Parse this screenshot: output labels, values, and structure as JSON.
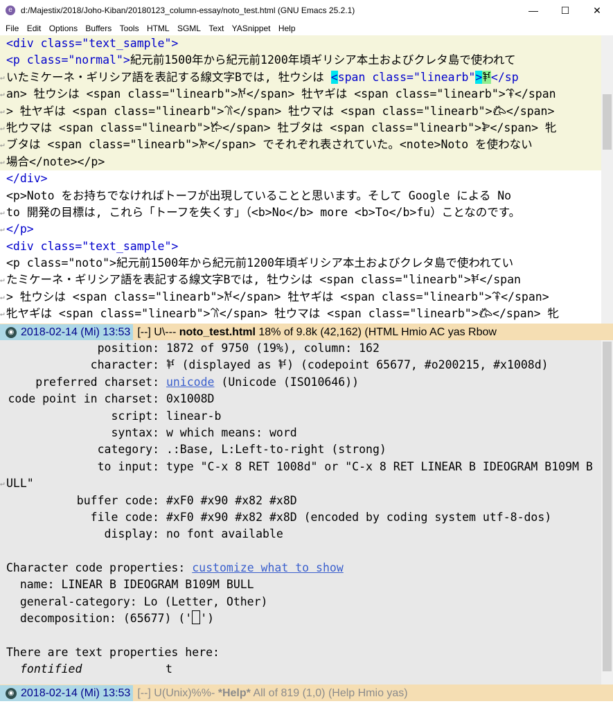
{
  "window": {
    "title": "d:/Majestix/2018/Joho-Kiban/20180123_column-essay/noto_test.html (GNU Emacs 25.2.1)",
    "minimize": "—",
    "maximize": "☐",
    "close": "✕"
  },
  "menu": [
    "File",
    "Edit",
    "Options",
    "Buffers",
    "Tools",
    "HTML",
    "SGML",
    "Text",
    "YASnippet",
    "Help"
  ],
  "editor": {
    "l1_tag": "<div class=\"text_sample\">",
    "l2a": "<p class=\"normal\">",
    "l2b": "紀元前1500年から紀元前1200年頃ギリシア本土およびクレタ島で使われて",
    "l3a": "いたミケーネ・ギリシア語を表記する線文字Bでは, 牡ウシは ",
    "l3_cursor": "<",
    "l3b": "span class=\"linearb\"",
    "l3_cursor2": ">",
    "l3_tofu": "𐂍",
    "l3c": "</sp",
    "l4": "an> 牡ウシは <span class=\"linearb\">𐂌</span> 牡ヤギは <span class=\"linearb\">𐂉</span",
    "l5": "> 牡ヤギは <span class=\"linearb\">𐂈</span> 牡ウマは <span class=\"linearb\">𐂃</span>",
    "l6": "牝ウマは <span class=\"linearb\">𐂂</span> 牡ブタは <span class=\"linearb\">𐂋</span> 牝",
    "l7": "ブタは <span class=\"linearb\">𐂊</span> でそれぞれ表されていた。<note>Noto を使わない",
    "l8": "場合</note></p>",
    "l9": "</div>",
    "l10": "<p>Noto をお持ちでなければトーフが出現していることと思います。そして Google による No",
    "l11": "to 開発の目標は, これら「トーフを失くす」（<b>No</b> more <b>To</b>fu）ことなのです。",
    "l12": "</p>",
    "l13": "<div class=\"text_sample\">",
    "l14": "<p class=\"noto\">紀元前1500年から紀元前1200年頃ギリシア本土およびクレタ島で使われてい",
    "l15": "たミケーネ・ギリシア語を表記する線文字Bでは, 牡ウシは <span class=\"linearb\">𐂍</span",
    "l16": "> 牡ウシは <span class=\"linearb\">𐂌</span> 牡ヤギは <span class=\"linearb\">𐂉</span>",
    "l17": "牝ヤギは <span class=\"linearb\">𐂈</span> 牡ウマは <span class=\"linearb\">𐂃</span> 牝"
  },
  "modeline_top": {
    "date": "2018-02-14 (Mi) 13:53",
    "status": "[--] U\\---  ",
    "buffer": "noto_test.html",
    "position": "  18% of 9.8k (42,162)",
    "modes": "  (HTML Hmio AC yas Rbow"
  },
  "help": {
    "position_label": "position:",
    "position_value": "1872 of 9750 (19%), column: 162",
    "character_label": "character:",
    "character_value": "𐂍 (displayed as 𐂍) (codepoint 65677, #o200215, #x1008d)",
    "charset_label": "preferred charset:",
    "charset_link": "unicode",
    "charset_value": " (Unicode (ISO10646))",
    "codepoint_label": "code point in charset:",
    "codepoint_value": "0x1008D",
    "script_label": "script:",
    "script_value": "linear-b",
    "syntax_label": "syntax:",
    "syntax_value": "w    which means: word",
    "category_label": "category:",
    "category_value": ".:Base, L:Left-to-right (strong)",
    "input_label": "to input:",
    "input_value": "type \"C-x 8 RET 1008d\" or \"C-x 8 RET LINEAR B IDEOGRAM B109M B",
    "input_cont": "ULL\"",
    "buffer_code_label": "buffer code:",
    "buffer_code_value": "#xF0 #x90 #x82 #x8D",
    "file_code_label": "file code:",
    "file_code_value": "#xF0 #x90 #x82 #x8D (encoded by coding system utf-8-dos)",
    "display_label": "display:",
    "display_value": "no font available",
    "props_label": "Character code properties: ",
    "props_link": "customize what to show",
    "name_line": "  name: LINEAR B IDEOGRAM B109M BULL",
    "gc_line": "  general-category: Lo (Letter, Other)",
    "decomp_a": "  decomposition: (65677) ('",
    "decomp_b": "')",
    "text_props": "There are text properties here:",
    "fontified": "fontified",
    "fontified_value": "t"
  },
  "modeline_bottom": {
    "date": "2018-02-14 (Mi) 13:53",
    "status": "[--] U(Unix)%%-  ",
    "buffer": "*Help*",
    "position": "       All of 819  (1,0)",
    "modes": "      (Help Hmio yas)"
  }
}
